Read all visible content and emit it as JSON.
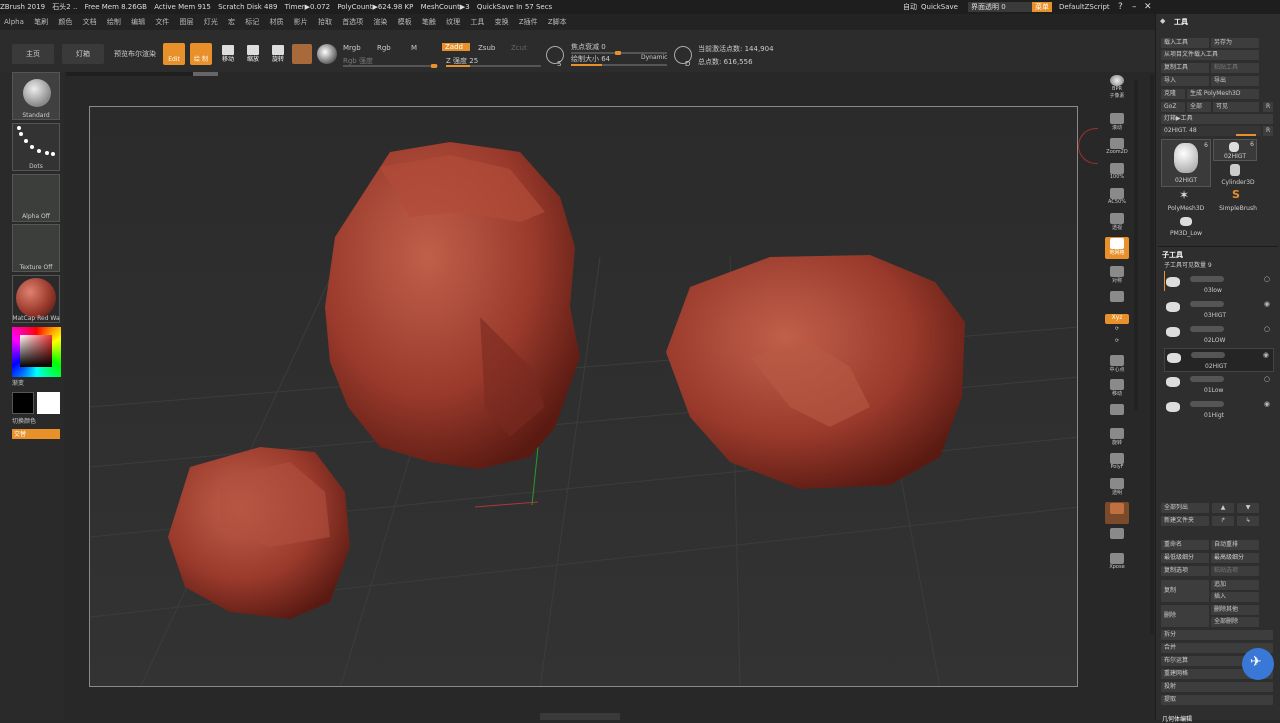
{
  "titlebar": {
    "items": [
      "ZBrush 2019",
      "石头2 ..",
      "Free Mem 8.26GB",
      "Active Mem 915",
      "Scratch Disk 489",
      "Timer▶0.072",
      "PolyCount▶624.98 KP",
      "MeshCount▶3",
      "QuickSave In 57 Secs"
    ],
    "right_misc": "自动",
    "quicksave": "QuickSave",
    "ui_opacity": "界面透明 0",
    "menus_btn": "菜单",
    "default_script": "DefaultZScript"
  },
  "menubar": [
    "Alpha",
    "笔刷",
    "颜色",
    "文档",
    "绘制",
    "编辑",
    "文件",
    "图层",
    "灯光",
    "宏",
    "标记",
    "材质",
    "影片",
    "拾取",
    "首选项",
    "渲染",
    "模板",
    "笔触",
    "纹理",
    "工具",
    "变换",
    "Z插件",
    "Z脚本"
  ],
  "shelf": {
    "home": "主页",
    "lightbox": "灯箱",
    "preview_render": "预览布尔渲染",
    "edit": "Edit",
    "draw": "绘 制",
    "move": "移动",
    "scale": "缩放",
    "rotate": "旋转",
    "mrgb": "Mrgb",
    "rgb": "Rgb",
    "m": "M",
    "zadd": "Zadd",
    "zsub": "Zsub",
    "zcut": "Zcut",
    "rgb_intensity": "Rgb 强度",
    "z_intensity": "Z 强度 25",
    "focal_shift": "焦点衰减 0",
    "draw_size": "绘制大小 64",
    "dynamic": "Dynamic",
    "active_points": "当前激活点数: 144,904",
    "total_points": "总点数: 616,556",
    "z_intensity_value": 25,
    "draw_size_value": 64
  },
  "leftbar": {
    "brush": "Standard",
    "stroke": "Dots",
    "alpha": "Alpha Off",
    "texture": "Texture Off",
    "material": "MatCap Red Wa",
    "gradient": "渐变",
    "switch_color": "切换颜色",
    "alternate": "交替"
  },
  "rightstrip": [
    "BPR",
    "子像素",
    "滚动",
    "Zoom2D",
    "100%",
    "AC50%",
    "透视",
    "地网格",
    "对称",
    "",
    "Xyz",
    "",
    "",
    "中心点",
    "移动",
    "",
    "旋转",
    "PolyF",
    "透明",
    "",
    "",
    "Xpose"
  ],
  "rpanel": {
    "title": "工具",
    "load_tool": "载入工具",
    "save_as": "另存为",
    "load_from_project": "从项目文件载入工具",
    "copy_tool": "复制工具",
    "paste_tool": "粘贴工具",
    "import": "导入",
    "export": "导出",
    "clone": "克隆",
    "make_polymesh": "生成 PolyMesh3D",
    "goz": "GoZ",
    "all": "全部",
    "visible": "可见",
    "r": "R",
    "lightbox_tool": "灯箱▶工具",
    "current_tool": "02HIGT. 48",
    "tools": [
      {
        "name": "02HIGT",
        "count": "6"
      },
      {
        "name": "02HIGT",
        "count": "6"
      },
      {
        "name": "Cylinder3D",
        "count": ""
      },
      {
        "name": "PolyMesh3D",
        "count": ""
      },
      {
        "name": "SimpleBrush",
        "count": ""
      },
      {
        "name": "PM3D_Low",
        "count": ""
      }
    ],
    "subtool_title": "子工具",
    "subtool_count": "子工具可见数量 9",
    "subtools": [
      "03low",
      "03HIGT",
      "02LOW",
      "02HIGT",
      "01Low",
      "01Higt"
    ],
    "list_all": "全部列出",
    "new_folder": "新建文件夹",
    "rename": "重命名",
    "auto_reorder": "自动重排",
    "lowest_subdiv": "最低级细分",
    "highest_subdiv": "最高级细分",
    "copy_subtool": "复制选项",
    "paste_subtool": "粘贴选项",
    "duplicate": "复制",
    "append": "追加",
    "insert": "插入",
    "delete": "删除",
    "delete_other": "删除其他",
    "delete_all": "全部删除",
    "split": "拆分",
    "merge": "合并",
    "boolean": "布尔运算",
    "remesh": "重建网格",
    "project": "投射",
    "extract": "提取",
    "geometry": "几何体编辑"
  },
  "colors": {
    "accent": "#e8902a",
    "rock": "#9a3a2c"
  }
}
